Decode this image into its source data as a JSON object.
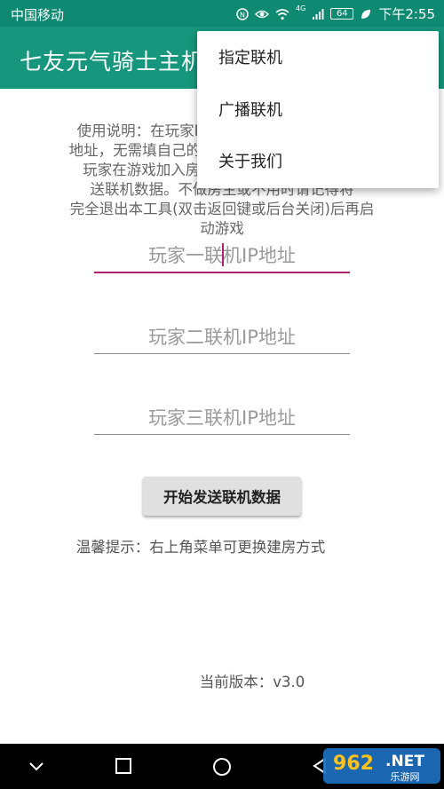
{
  "status_bar": {
    "carrier": "中国移动",
    "battery": "64",
    "network": "4G",
    "time": "下午2:55"
  },
  "app_bar": {
    "title": "七友元气骑士主机",
    "color": "#16977d"
  },
  "instructions": {
    "lines": [
      "使用说明：在玩家IP栏填入其他玩家的联机IP",
      "地址，无需填自己的IP，填完后点击发送，其他",
      "玩家在游戏加入房间即可。本工具会持续发",
      "送联机数据。不做房主或不用时请记得将",
      "完全退出本工具(双击返回键或后台关闭)后再启",
      "动游戏"
    ]
  },
  "inputs": [
    {
      "placeholder": "玩家一联机IP地址",
      "value": ""
    },
    {
      "placeholder": "玩家二联机IP地址",
      "value": ""
    },
    {
      "placeholder": "玩家三联机IP地址",
      "value": ""
    }
  ],
  "send_button": {
    "label": "开始发送联机数据"
  },
  "tip": "温馨提示：右上角菜单可更换建房方式",
  "version": "当前版本：v3.0",
  "menu": {
    "items": [
      {
        "label": "指定联机"
      },
      {
        "label": "广播联机"
      },
      {
        "label": "关于我们"
      }
    ]
  },
  "watermark": {
    "text": "962.NET",
    "subtext": "乐游网"
  }
}
